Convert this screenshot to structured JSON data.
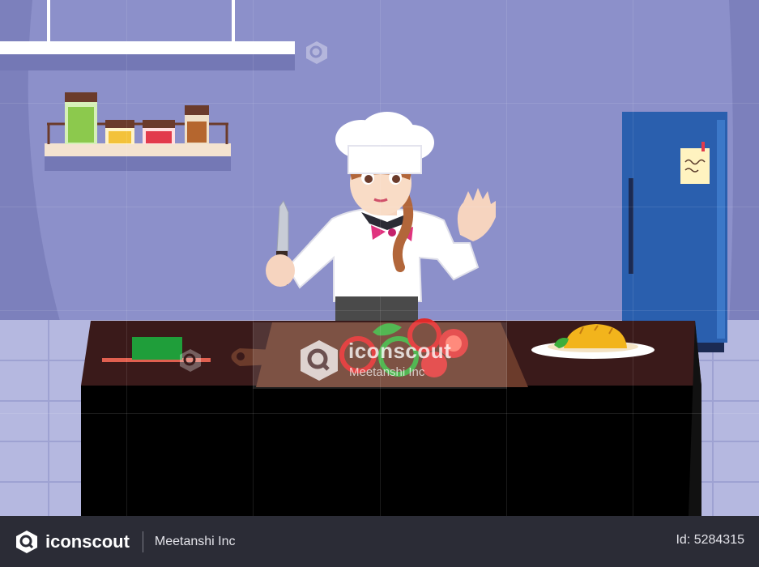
{
  "watermark": {
    "brand": "iconscout",
    "author": "Meetanshi Inc"
  },
  "footer": {
    "brand": "iconscout",
    "author": "Meetanshi Inc",
    "asset_id": "Id: 5284315"
  },
  "colors": {
    "wall": "#8b8fc6",
    "counter": "#000000",
    "counter_top": "#3a1a1a",
    "fridge": "#2a5fae",
    "footer_bg": "#2b2c36"
  },
  "icons": [
    "iconscout-logo-icon",
    "knife-icon",
    "chef-hat-icon"
  ]
}
